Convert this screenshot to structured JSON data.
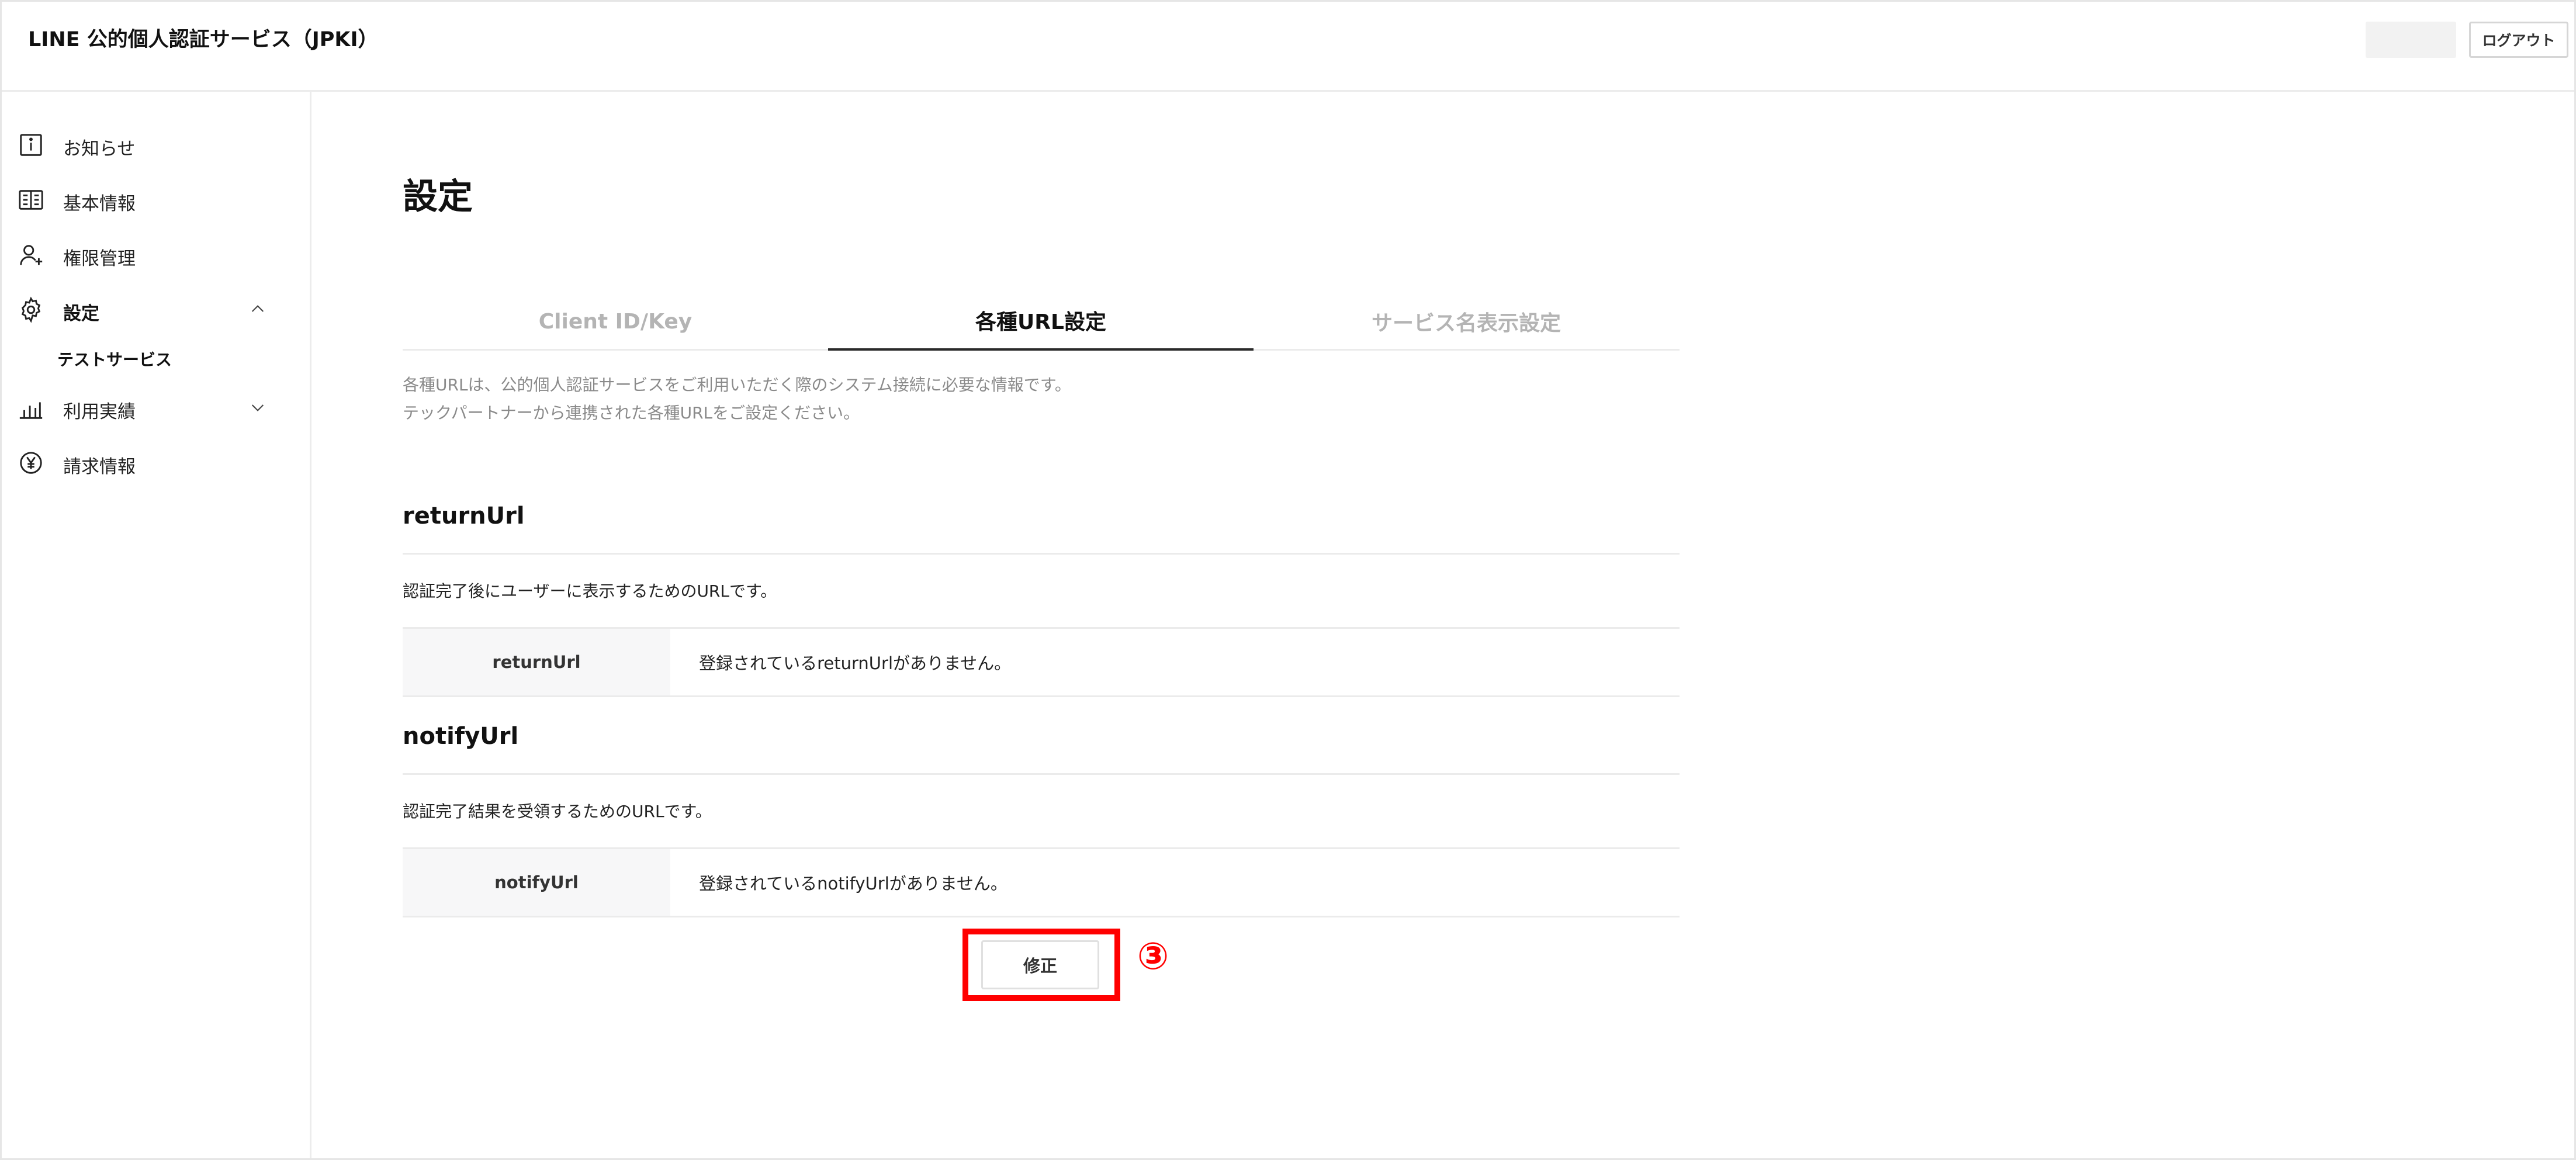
{
  "header": {
    "app_title": "LINE 公的個人認証サービス（JPKI）",
    "logout_label": "ログアウト"
  },
  "sidebar": {
    "items": [
      {
        "label": "お知らせ",
        "icon": "info-icon"
      },
      {
        "label": "基本情報",
        "icon": "book-icon"
      },
      {
        "label": "権限管理",
        "icon": "user-add-icon"
      },
      {
        "label": "設定",
        "icon": "gear-icon",
        "expanded": true
      },
      {
        "label": "利用実績",
        "icon": "bar-chart-icon",
        "expanded": false
      },
      {
        "label": "請求情報",
        "icon": "yen-icon"
      }
    ],
    "settings_sub_item": "テストサービス"
  },
  "main": {
    "page_title": "設定",
    "tabs": [
      {
        "label": "Client ID/Key",
        "active": false
      },
      {
        "label": "各種URL設定",
        "active": true
      },
      {
        "label": "サービス名表示設定",
        "active": false
      }
    ],
    "description_line1": "各種URLは、公的個人認証サービスをご利用いただく際のシステム接続に必要な情報です。",
    "description_line2": "テックパートナーから連携された各種URLをご設定ください。",
    "sections": [
      {
        "title": "returnUrl",
        "desc": "認証完了後にユーザーに表示するためのURLです。",
        "key": "returnUrl",
        "value": "登録されているreturnUrlがありません。"
      },
      {
        "title": "notifyUrl",
        "desc": "認証完了結果を受領するためのURLです。",
        "key": "notifyUrl",
        "value": "登録されているnotifyUrlがありません。"
      }
    ],
    "edit_label": "修正",
    "step_marker": "③"
  },
  "colors": {
    "highlight": "#ff0000",
    "active_tab_underline": "#2a2a2a",
    "inactive_tab_text": "#b4b4b4"
  }
}
